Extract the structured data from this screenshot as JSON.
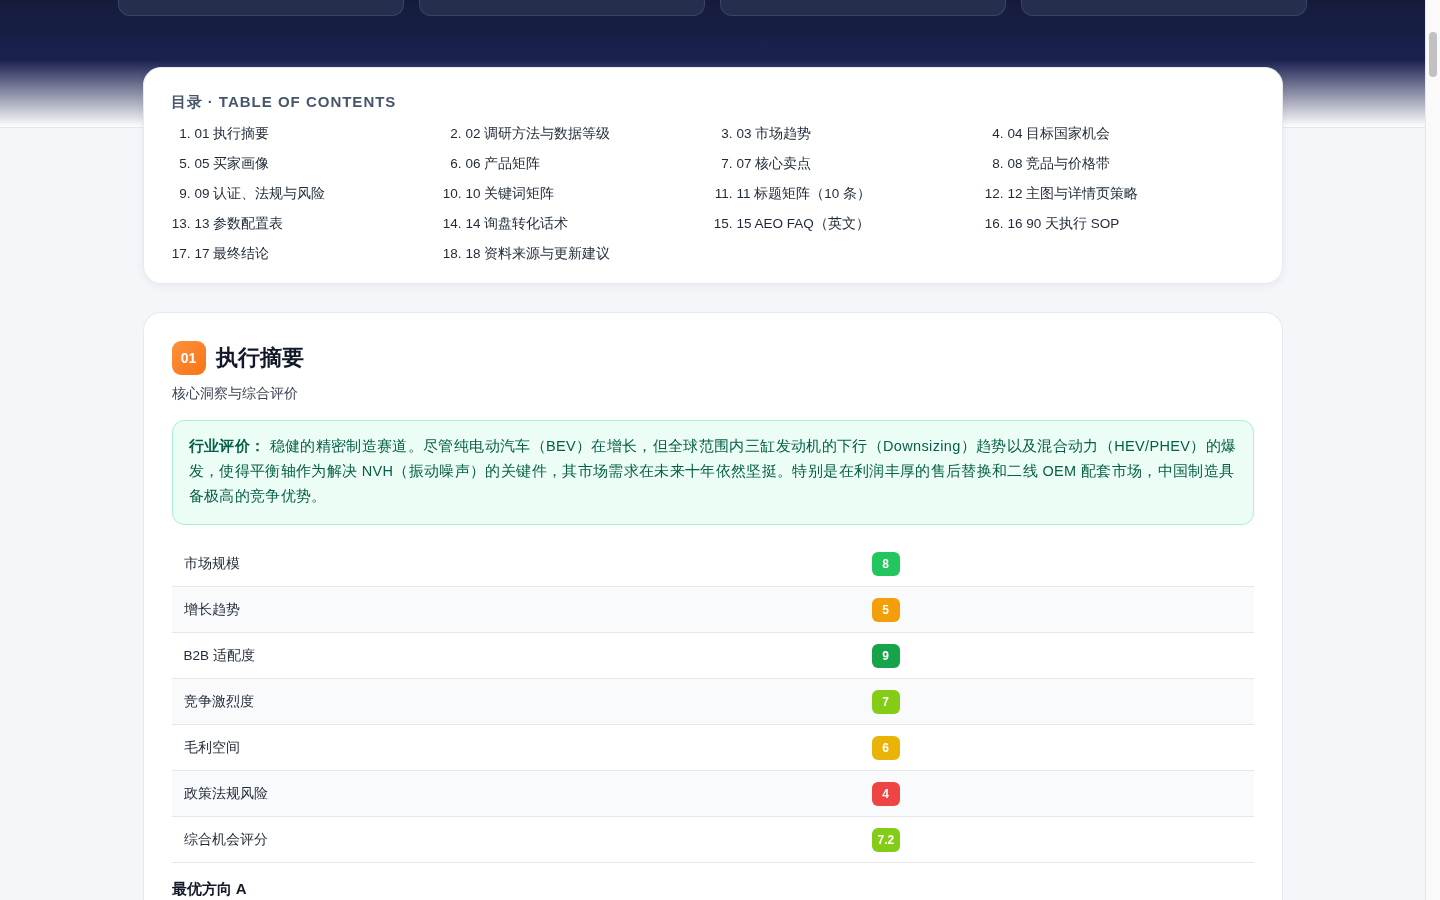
{
  "toc": {
    "title": "目录 · TABLE OF CONTENTS",
    "items": [
      {
        "number": "1.",
        "title": "01 执行摘要"
      },
      {
        "number": "2.",
        "title": "02 调研方法与数据等级"
      },
      {
        "number": "3.",
        "title": "03 市场趋势"
      },
      {
        "number": "4.",
        "title": "04 目标国家机会"
      },
      {
        "number": "5.",
        "title": "05 买家画像"
      },
      {
        "number": "6.",
        "title": "06 产品矩阵"
      },
      {
        "number": "7.",
        "title": "07 核心卖点"
      },
      {
        "number": "8.",
        "title": "08 竞品与价格带"
      },
      {
        "number": "9.",
        "title": "09 认证、法规与风险"
      },
      {
        "number": "10.",
        "title": "10 关键词矩阵"
      },
      {
        "number": "11.",
        "title": "11 标题矩阵（10 条）"
      },
      {
        "number": "12.",
        "title": "12 主图与详情页策略"
      },
      {
        "number": "13.",
        "title": "13 参数配置表"
      },
      {
        "number": "14.",
        "title": "14 询盘转化话术"
      },
      {
        "number": "15.",
        "title": "15 AEO FAQ（英文）"
      },
      {
        "number": "16.",
        "title": "16 90 天执行 SOP"
      },
      {
        "number": "17.",
        "title": "17 最终结论"
      },
      {
        "number": "18.",
        "title": "18 资料来源与更新建议"
      }
    ]
  },
  "section": {
    "number": "01",
    "title": "执行摘要",
    "subtitle": "核心洞察与综合评价",
    "callout": "**行业评价：**  稳健的精密制造赛道。尽管纯电动汽车（BEV）在增长，但全球范围内三缸发动机的下行（Downsizing）趋势以及混合动力（HEV/PHEV）的爆发，使得平衡轴作为解决 NVH（振动噪声）的关键件，其市场需求在未来十年依然坚挺。特别是在利润丰厚的售后替换和二线 OEM 配套市场，中国制造具备极高的竞争优势。",
    "scores": [
      {
        "label": "市场规模",
        "score": "8",
        "color": "#22c55e"
      },
      {
        "label": "增长趋势",
        "score": "5",
        "color": "#f59e0b"
      },
      {
        "label": "B2B 适配度",
        "score": "9",
        "color": "#16a34a"
      },
      {
        "label": "竞争激烈度",
        "score": "7",
        "color": "#84cc16"
      },
      {
        "label": "毛利空间",
        "score": "6",
        "color": "#eab308"
      },
      {
        "label": "政策法规风险",
        "score": "4",
        "color": "#ef4444"
      },
      {
        "label": "综合机会评分",
        "score": "7.2",
        "color": "#84cc16"
      }
    ],
    "next_heading": "最优方向 A"
  }
}
